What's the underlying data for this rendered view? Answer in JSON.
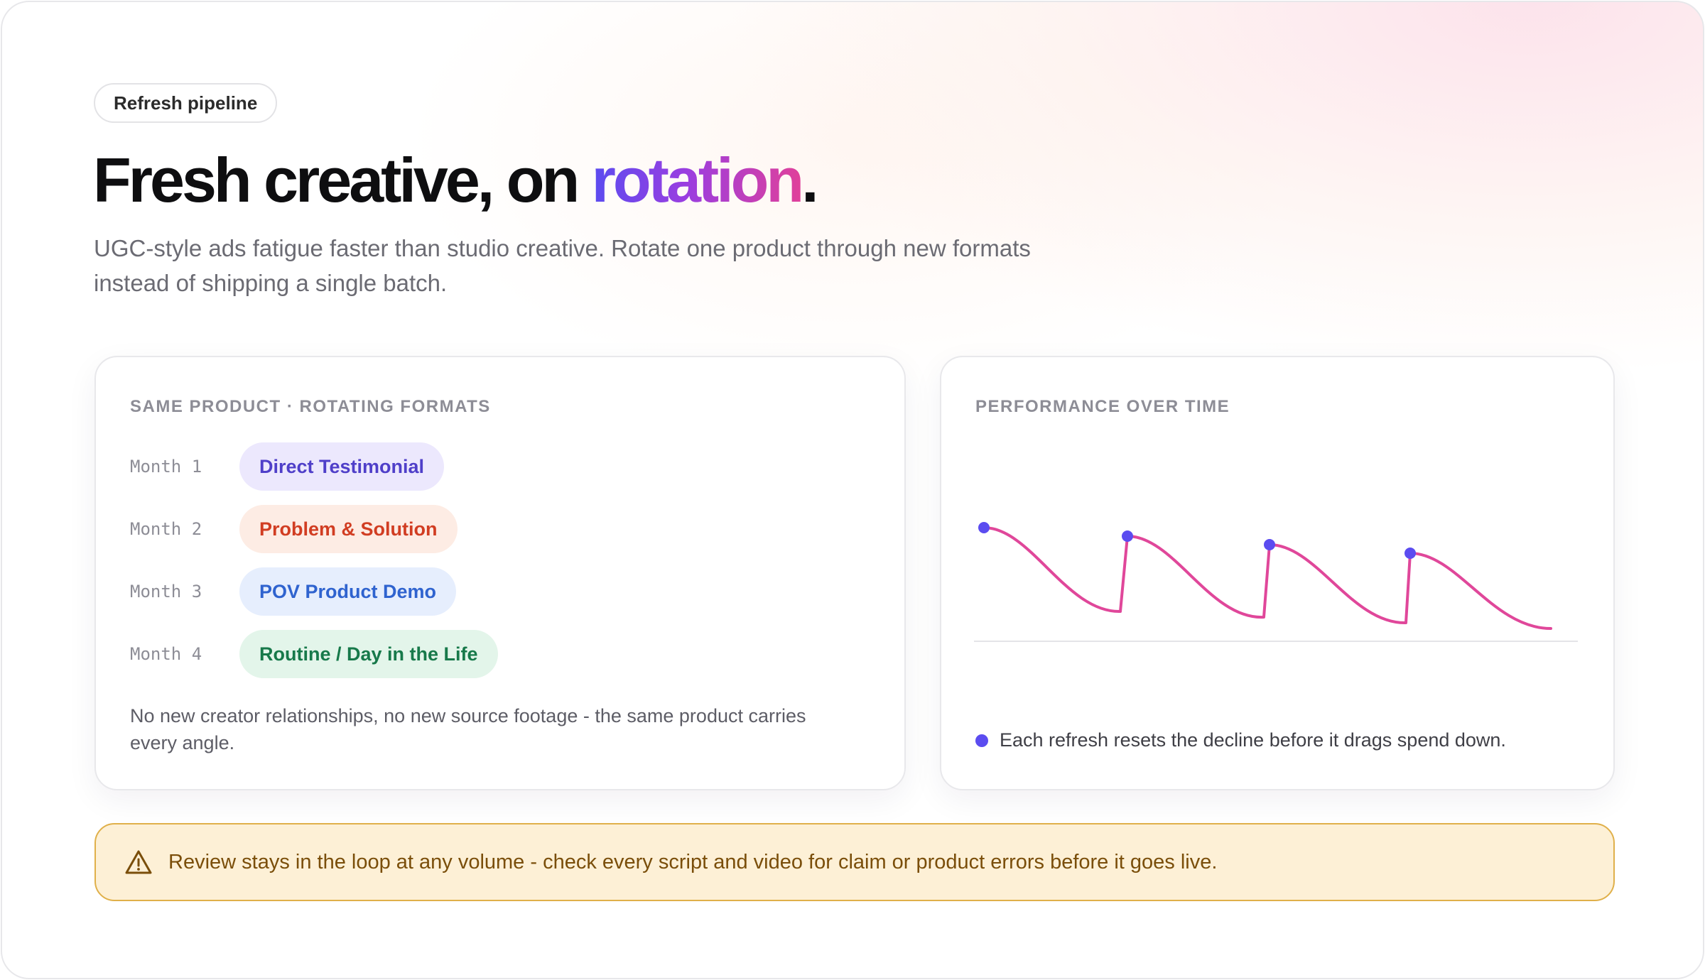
{
  "header": {
    "pill_label": "Refresh pipeline",
    "headline_main": "Fresh creative, on ",
    "headline_accent": "rotation",
    "headline_period": ".",
    "subtitle": "UGC-style ads fatigue faster than studio creative. Rotate one product through new formats instead of shipping a single batch."
  },
  "formats_card": {
    "label": "SAME PRODUCT · ROTATING FORMATS",
    "rows": [
      {
        "month": "Month 1",
        "format": "Direct Testimonial",
        "color": "#4f3fc9",
        "bg": "#ece8fd"
      },
      {
        "month": "Month 2",
        "format": "Problem & Solution",
        "color": "#d13d22",
        "bg": "#fdece4"
      },
      {
        "month": "Month 3",
        "format": "POV Product Demo",
        "color": "#2f63cf",
        "bg": "#e6eefd"
      },
      {
        "month": "Month 4",
        "format": "Routine / Day in the Life",
        "color": "#17794a",
        "bg": "#e3f5ea"
      }
    ],
    "note": "No new creator relationships, no new source footage - the same product carries every angle."
  },
  "performance_card": {
    "label": "PERFORMANCE OVER TIME",
    "legend_text": "Each refresh resets the decline before it drags spend down.",
    "line_color": "#e0479a",
    "marker_color": "#5b4cf0",
    "baseline_color": "#e4e4e8"
  },
  "banner": {
    "icon": "warning-triangle-icon",
    "text": "Review stays in the loop at any volume - check every script and video for claim or product errors before it goes live.",
    "color": "#7a4e0a"
  }
}
